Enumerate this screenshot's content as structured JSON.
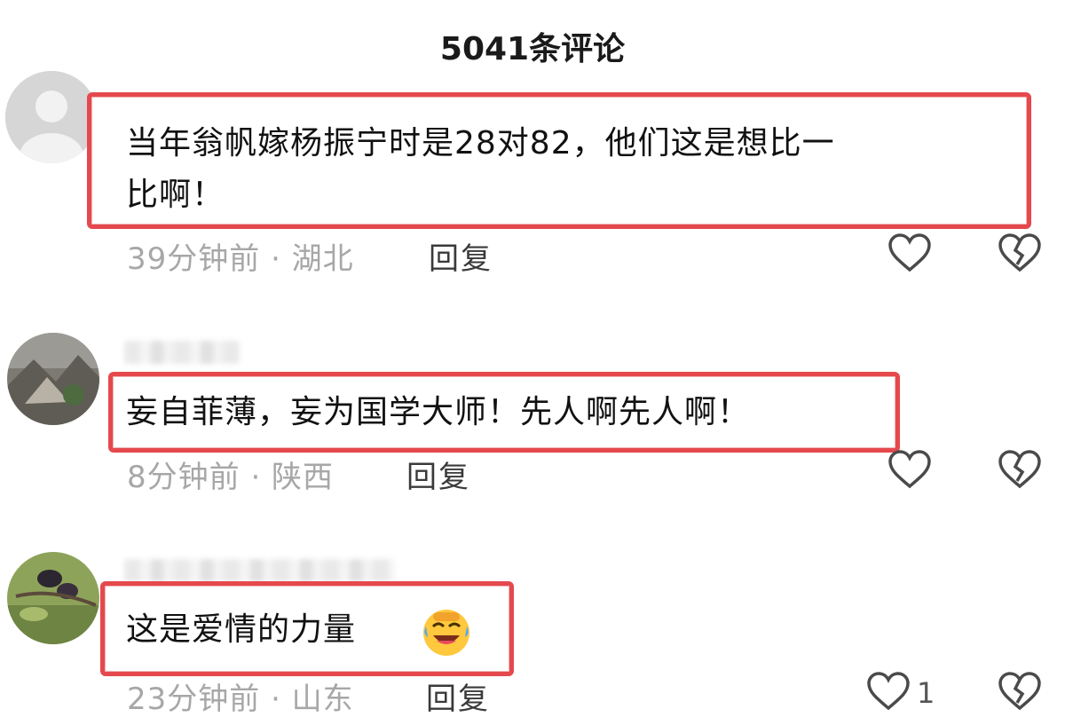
{
  "header": {
    "title": "5041条评论"
  },
  "comments": [
    {
      "text_line1": "当年翁帆嫁杨振宁时是28对82，他们这是想比一",
      "text_line2": "比啊！",
      "time_location": "39分钟前 · 湖北",
      "reply_label": "回复",
      "like_count": ""
    },
    {
      "text_line1": "妄自菲薄，妄为国学大师！先人啊先人啊！",
      "time_location": "8分钟前 · 陕西",
      "reply_label": "回复",
      "like_count": ""
    },
    {
      "text_line1": "这是爱情的力量",
      "emoji": "laughing-crying-emoji",
      "time_location": "23分钟前 · 山东",
      "reply_label": "回复",
      "like_count": "1"
    }
  ],
  "colors": {
    "highlight_border": "#e5484d",
    "meta_text": "#a7a7a7",
    "emoji_yellow": "#ffc83d"
  },
  "icons": [
    "heart-outline-icon",
    "broken-heart-icon",
    "avatar-default-icon"
  ]
}
